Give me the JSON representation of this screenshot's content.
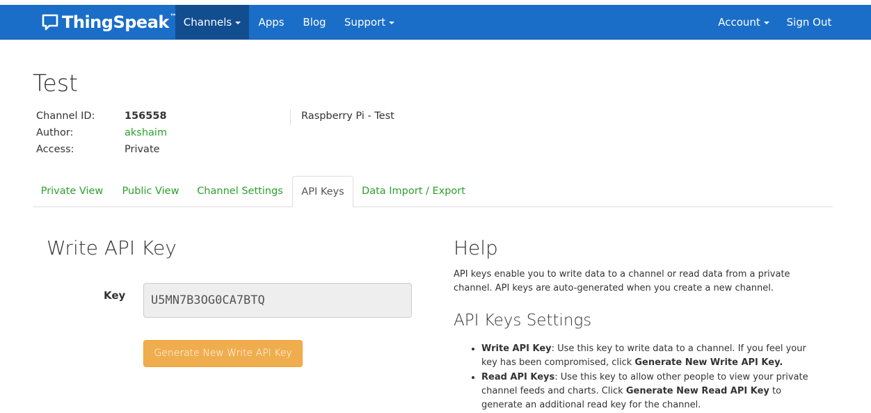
{
  "navbar": {
    "brand": "ThingSpeak",
    "brand_tm": "™",
    "items": {
      "channels": "Channels",
      "apps": "Apps",
      "blog": "Blog",
      "support": "Support",
      "account": "Account",
      "signout": "Sign Out"
    },
    "color": "#1a6ec8",
    "active_color": "#124e8f"
  },
  "channel": {
    "title": "Test",
    "id_label": "Channel ID:",
    "id_value": "156558",
    "author_label": "Author:",
    "author_value": "akshaim",
    "access_label": "Access:",
    "access_value": "Private",
    "description": "Raspberry Pi - Test"
  },
  "tabs": [
    {
      "label": "Private View"
    },
    {
      "label": "Public View"
    },
    {
      "label": "Channel Settings"
    },
    {
      "label": "API Keys"
    },
    {
      "label": "Data Import / Export"
    }
  ],
  "write_key": {
    "heading": "Write API Key",
    "key_label": "Key",
    "key_value": "U5MN7B3OG0CA7BTQ",
    "button_label": "Generate New Write API Key"
  },
  "help": {
    "heading": "Help",
    "paragraph": "API keys enable you to write data to a channel or read data from a private channel. API keys are auto-generated when you create a new channel.",
    "settings_heading": "API Keys Settings",
    "items": [
      {
        "term": "Write API Key",
        "text_before": ": Use this key to write data to a channel. If you feel your key has been compromised, click ",
        "action": "Generate New Write API Key.",
        "text_after": ""
      },
      {
        "term": "Read API Keys",
        "text_before": ": Use this key to allow other people to view your private channel feeds and charts. Click ",
        "action": "Generate New Read API Key",
        "text_after": " to generate an additional read key for the channel."
      }
    ]
  },
  "colors": {
    "link_green": "#2ca02c",
    "button_orange": "#f0ad4e"
  }
}
